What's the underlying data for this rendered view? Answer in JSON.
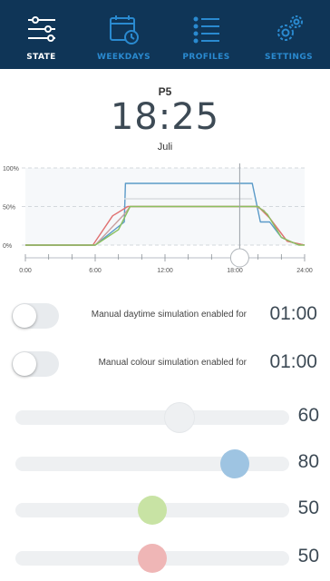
{
  "nav": {
    "items": [
      {
        "label": "STATE",
        "icon": "sliders-icon",
        "active": true
      },
      {
        "label": "WEEKDAYS",
        "icon": "calendar-clock-icon",
        "active": false
      },
      {
        "label": "PROFILES",
        "icon": "list-icon",
        "active": false
      },
      {
        "label": "SETTINGS",
        "icon": "gears-icon",
        "active": false
      }
    ]
  },
  "status": {
    "program": "P5",
    "time": "18:25",
    "month": "Juli"
  },
  "chart_data": {
    "type": "line",
    "y_tick_labels": [
      "100%",
      "50%",
      "0%"
    ],
    "x_tick_labels": [
      "0:00",
      "6:00",
      "12:00",
      "18:00",
      "24:00"
    ],
    "xlim": [
      0,
      24
    ],
    "ylim": [
      0,
      100
    ],
    "grid": true,
    "current_time": 18.42,
    "series": [
      {
        "color": "#5a9ac8",
        "x": [
          0,
          6,
          8.5,
          8.6,
          19.5,
          20.2,
          21,
          22,
          23,
          24
        ],
        "y": [
          0,
          0,
          30,
          80,
          80,
          30,
          30,
          10,
          3,
          0
        ]
      },
      {
        "color": "#c8a0a0",
        "x": [
          0,
          6,
          8.5,
          9,
          19.8,
          20.5,
          22.5,
          24
        ],
        "y": [
          0,
          0,
          40,
          50,
          50,
          45,
          5,
          0
        ]
      },
      {
        "color": "#e07070",
        "x": [
          0,
          5.8,
          7.5,
          8.8,
          20,
          21,
          22.5,
          24
        ],
        "y": [
          0,
          0,
          38,
          50,
          50,
          35,
          5,
          0
        ]
      },
      {
        "color": "#8ac060",
        "x": [
          0,
          6,
          8,
          9,
          20,
          20.8,
          22,
          23.5,
          24
        ],
        "y": [
          0,
          0,
          20,
          50,
          50,
          40,
          10,
          0,
          0
        ]
      },
      {
        "color": "#d8dce0",
        "x": [
          8.5,
          19.5
        ],
        "y": [
          60,
          60
        ]
      }
    ]
  },
  "toggles": [
    {
      "label": "Manual daytime simulation enabled for",
      "value": "01:00"
    },
    {
      "label": "Manual colour simulation enabled for",
      "value": "01:00"
    }
  ],
  "sliders": [
    {
      "value": "60",
      "level": 0.6,
      "color": "#eef0f2"
    },
    {
      "value": "80",
      "level": 0.8,
      "color": "#9ec4e2"
    },
    {
      "value": "50",
      "level": 0.5,
      "color": "#c8e3a4"
    },
    {
      "value": "50",
      "level": 0.5,
      "color": "#efb6b6"
    }
  ]
}
